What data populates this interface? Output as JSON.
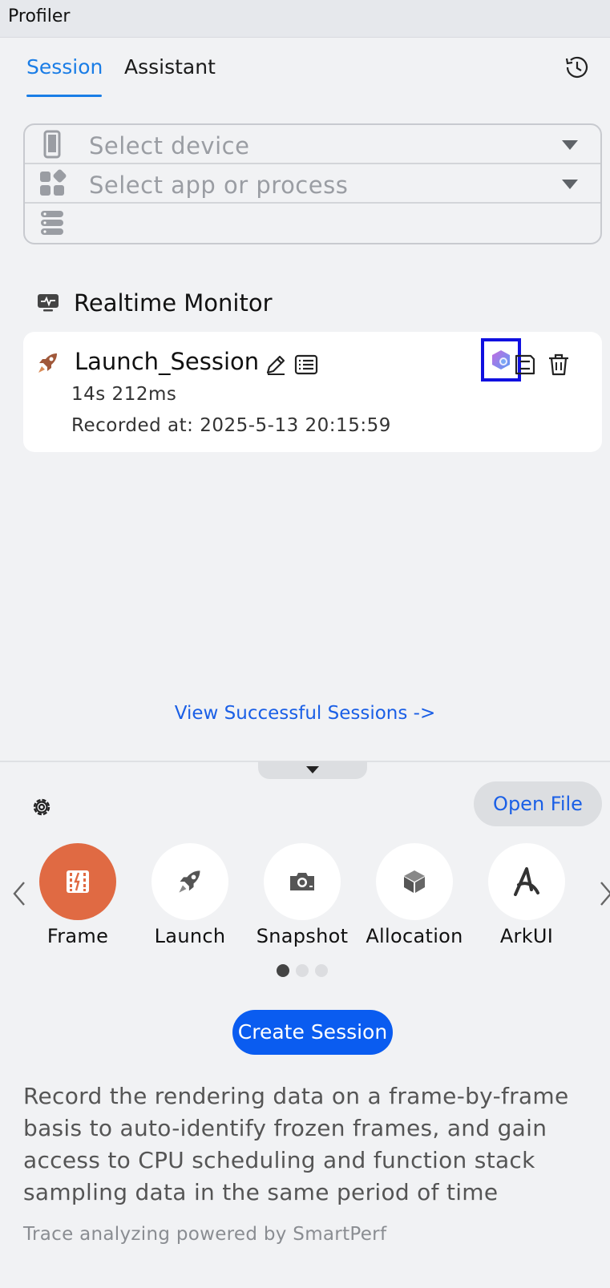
{
  "window": {
    "title": "Profiler"
  },
  "tabs": [
    {
      "label": "Session",
      "active": true
    },
    {
      "label": "Assistant",
      "active": false
    }
  ],
  "selectors": {
    "device_placeholder": "Select device",
    "app_placeholder": "Select app or process"
  },
  "monitor": {
    "title": "Realtime Monitor"
  },
  "session": {
    "name": "Launch_Session",
    "duration": "14s 212ms",
    "recorded": "Recorded at: 2025-5-13 20:15:59"
  },
  "links": {
    "view_sessions": "View Successful Sessions ->"
  },
  "toolbar": {
    "open_file": "Open File",
    "create_session": "Create Session"
  },
  "tools": [
    {
      "label": "Frame",
      "icon": "frame-icon",
      "active": true
    },
    {
      "label": "Launch",
      "icon": "rocket-icon",
      "active": false
    },
    {
      "label": "Snapshot",
      "icon": "camera-icon",
      "active": false
    },
    {
      "label": "Allocation",
      "icon": "cube-icon",
      "active": false
    },
    {
      "label": "ArkUI",
      "icon": "arkui-icon",
      "active": false
    }
  ],
  "pager": {
    "pages": 3,
    "current": 1
  },
  "description": "Record the rendering data on a frame-by-frame basis to auto-identify frozen frames, and gain access to CPU scheduling and function stack sampling data in the same period of time",
  "footer": {
    "powered": "Trace analyzing powered by SmartPerf"
  },
  "colors": {
    "accent": "#1a7de6",
    "primary_button": "#0a5cf0",
    "active_tool": "#e06a43",
    "highlight": "#1010e0"
  }
}
